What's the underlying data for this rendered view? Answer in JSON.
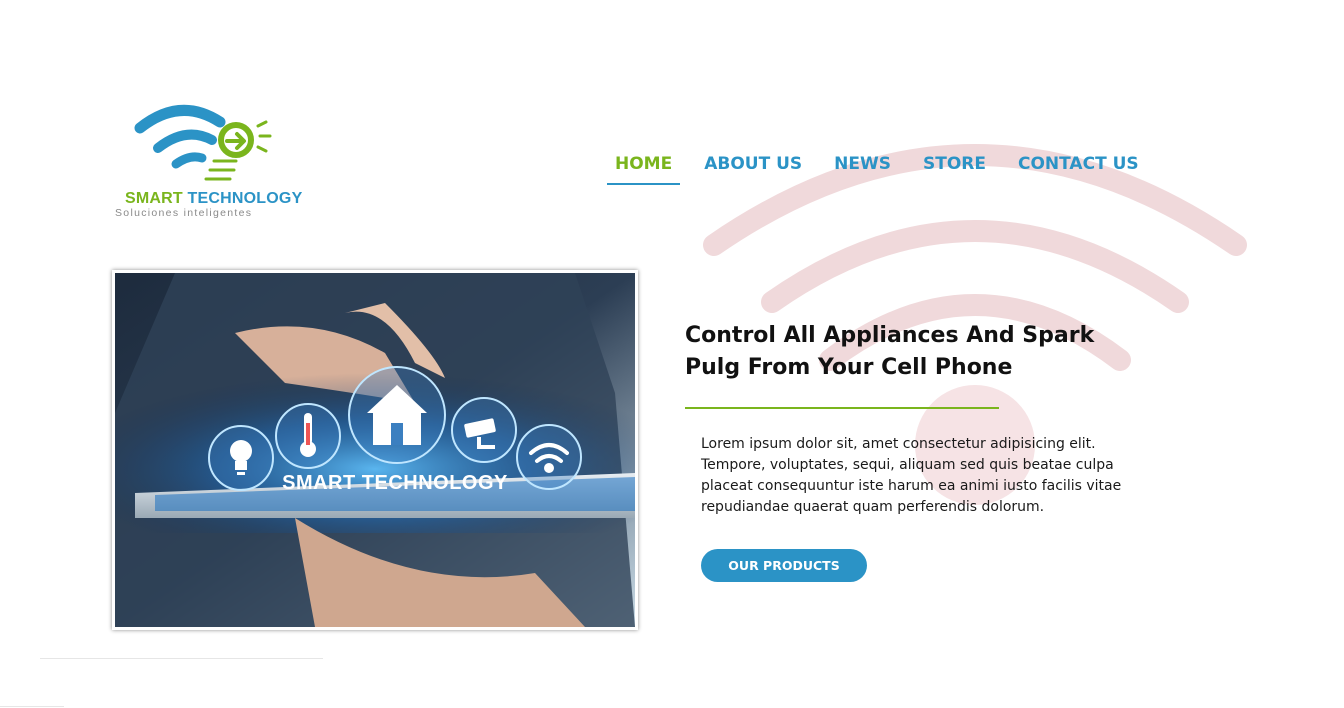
{
  "brand": {
    "name_part1": "SMART",
    "name_part2": "TECHNOLOGY",
    "tagline": "Soluciones inteligentes",
    "colors": {
      "green": "#7ab51d",
      "blue": "#2b93c6",
      "watermark": "#f0d9db"
    }
  },
  "nav": {
    "items": [
      {
        "label": "HOME",
        "active": true
      },
      {
        "label": "ABOUT US",
        "active": false
      },
      {
        "label": "NEWS",
        "active": false
      },
      {
        "label": "STORE",
        "active": false
      },
      {
        "label": "CONTACT US",
        "active": false
      }
    ]
  },
  "hero": {
    "image_caption": "SMART TECHNOLOGY",
    "image_icons": [
      "bulb-icon",
      "thermometer-icon",
      "home-icon",
      "camera-icon",
      "wifi-icon"
    ],
    "headline": "Control All Appliances And Spark Pulg From Your Cell Phone",
    "body": "Lorem ipsum dolor sit, amet consectetur adipisicing elit. Tempore, voluptates, sequi, aliquam sed quis beatae culpa placeat consequuntur iste harum ea animi iusto facilis vitae repudiandae quaerat quam perferendis dolorum.",
    "cta_label": "OUR PRODUCTS"
  }
}
